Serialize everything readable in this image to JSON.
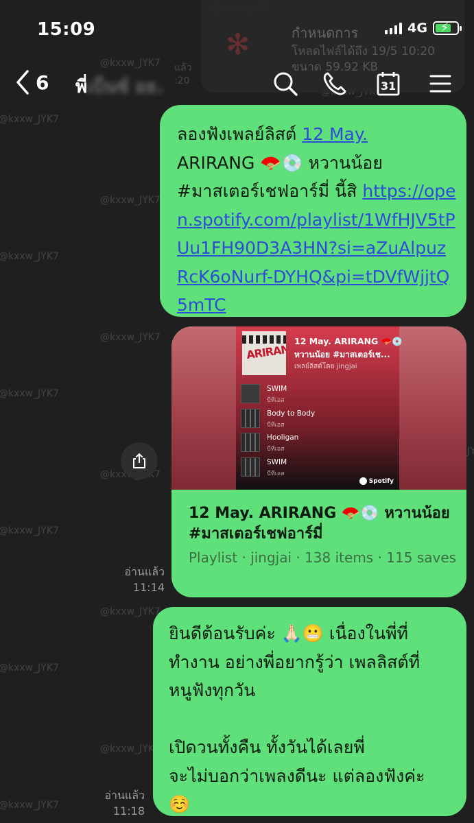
{
  "status_bar": {
    "time": "15:09",
    "network": "4G"
  },
  "file_overlay": {
    "title": "กำหนดการ",
    "line1": "โหลดไฟล์ได้ถึง 19/5 10:20",
    "line2": "ขนาด 59.92 KB",
    "behind_line1": "แล้ว",
    "behind_line2": ":20"
  },
  "watermark": "@kxxw_JYK7",
  "nav": {
    "back_count": "6",
    "chat_name_visible": "พี่",
    "chat_name_blurred": "เบ็นซ์ อธ."
  },
  "messages": [
    {
      "text_prefix": "ลองฟังเพลย์ลิสต์ ",
      "link1": "12 May.",
      "text_mid": "ARIRANG 🪭💿 หวานน้อย",
      "text_mid2": "#มาสเตอร์เชฟอาร์มี่ นี้สิ ",
      "url": "https://open.spotify.com/playlist/1WfHJV5tPUu1FH90D3A3HN?si=aZuAlpuzRcK6oNurf-DYHQ&pi=tDVfWjjtQ5mTC"
    }
  ],
  "preview": {
    "cover_text": "ARIRANG",
    "card_title": "12 May. ARIRANG 🪭💿",
    "card_subtitle": "หวานน้อย #มาสเตอร์เช...",
    "card_owner": "เพลย์ลิสต์โดย jingjai",
    "tracks": [
      {
        "name": "SWIM",
        "artist": "บีทีเอส"
      },
      {
        "name": "Body to Body",
        "artist": "บีทีเอส"
      },
      {
        "name": "Hooligan",
        "artist": "บีทีเอส"
      },
      {
        "name": "SWIM",
        "artist": "บีทีเอส"
      }
    ],
    "badge": "Spotify",
    "title": "12 May. ARIRANG 🪭💿 หวานน้อย #มาสเตอร์เชฟอาร์มี่",
    "meta": "Playlist · jingjai · 138 items · 115 saves"
  },
  "read_receipts": [
    {
      "status": "อ่านแล้ว",
      "time": "11:14"
    },
    {
      "status": "อ่านแล้ว",
      "time": "11:18"
    }
  ],
  "message3": {
    "line1": "ยินดีต้อนรับค่ะ 🙏🏻😬 เนื่องในพี่ที่",
    "line2": "ทำงาน อย่างพี่อยากรู้ว่า เพลลิสต์ที่",
    "line3": "หนูฟังทุกวัน",
    "line4": "เปิดวนทั้งคืน ทั้งวันได้เลยพี่",
    "line5": "จะไม่บอกว่าเพลงดีนะ แต่ลองฟังค่ะ",
    "line6": "☺️"
  },
  "calendar_day": "31"
}
